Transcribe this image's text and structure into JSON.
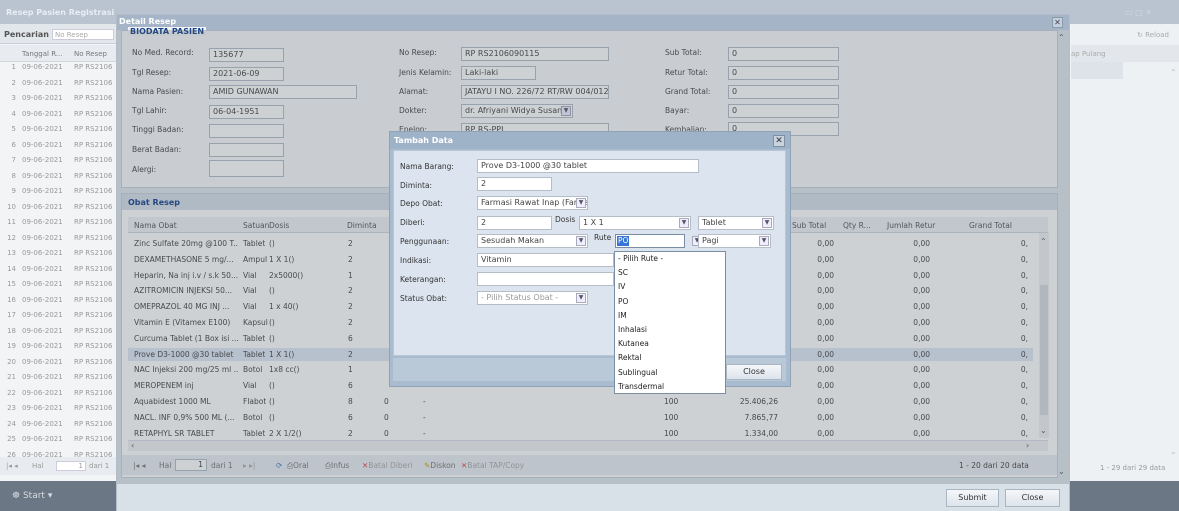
{
  "background": {
    "title": "Resep Pasien Registrasi",
    "search_label": "Pencarian :",
    "search_placeholder": "No Resep",
    "columns": [
      "Tanggal R...",
      "No Resep"
    ],
    "rows": [
      {
        "n": "1",
        "tgl": "09-06-2021",
        "no": "RP RS2106"
      },
      {
        "n": "2",
        "tgl": "09-06-2021",
        "no": "RP RS2106"
      },
      {
        "n": "3",
        "tgl": "09-06-2021",
        "no": "RP RS2106"
      },
      {
        "n": "4",
        "tgl": "09-06-2021",
        "no": "RP RS2106"
      },
      {
        "n": "5",
        "tgl": "09-06-2021",
        "no": "RP RS2106"
      },
      {
        "n": "6",
        "tgl": "09-06-2021",
        "no": "RP RS2106"
      },
      {
        "n": "7",
        "tgl": "09-06-2021",
        "no": "RP RS2106"
      },
      {
        "n": "8",
        "tgl": "09-06-2021",
        "no": "RP RS2106"
      },
      {
        "n": "9",
        "tgl": "09-06-2021",
        "no": "RP RS2106"
      },
      {
        "n": "10",
        "tgl": "09-06-2021",
        "no": "RP RS2106"
      },
      {
        "n": "11",
        "tgl": "09-06-2021",
        "no": "RP RS2106"
      },
      {
        "n": "12",
        "tgl": "09-06-2021",
        "no": "RP RS2106"
      },
      {
        "n": "13",
        "tgl": "09-06-2021",
        "no": "RP RS2106"
      },
      {
        "n": "14",
        "tgl": "09-06-2021",
        "no": "RP RS2106"
      },
      {
        "n": "15",
        "tgl": "09-06-2021",
        "no": "RP RS2106"
      },
      {
        "n": "16",
        "tgl": "09-06-2021",
        "no": "RP RS2106"
      },
      {
        "n": "17",
        "tgl": "09-06-2021",
        "no": "RP RS2106"
      },
      {
        "n": "18",
        "tgl": "09-06-2021",
        "no": "RP RS2106"
      },
      {
        "n": "19",
        "tgl": "09-06-2021",
        "no": "RP RS2106"
      },
      {
        "n": "20",
        "tgl": "09-06-2021",
        "no": "RP RS2106"
      },
      {
        "n": "21",
        "tgl": "09-06-2021",
        "no": "RP RS2106"
      },
      {
        "n": "22",
        "tgl": "09-06-2021",
        "no": "RP RS2106"
      },
      {
        "n": "23",
        "tgl": "09-06-2021",
        "no": "RP RS2106"
      },
      {
        "n": "24",
        "tgl": "09-06-2021",
        "no": "RP RS2106"
      },
      {
        "n": "25",
        "tgl": "09-06-2021",
        "no": "RP RS2106"
      },
      {
        "n": "26",
        "tgl": "09-06-2021",
        "no": "RP RS2106"
      }
    ],
    "pager_hal": "Hal",
    "pager_page": "1",
    "pager_of": "dari 1",
    "right_column": "ap Pulang",
    "reload": "Reload",
    "right_footer": "1 - 29 dari 29 data",
    "start": "Start"
  },
  "detail": {
    "title": "Detail Resep",
    "biodata_title": "BIODATA PASIEN",
    "fields": {
      "no_med_label": "No Med. Record:",
      "no_med": "135677",
      "tgl_resep_label": "Tgl Resep:",
      "tgl_resep": "2021-06-09",
      "nama_label": "Nama Pasien:",
      "nama": "AMID GUNAWAN",
      "tgl_lahir_label": "Tgl Lahir:",
      "tgl_lahir": "06-04-1951",
      "tinggi_label": "Tinggi Badan:",
      "berat_label": "Berat Badan:",
      "alergi_label": "Alergi:",
      "no_resep_label": "No Resep:",
      "no_resep": "RP RS2106090115",
      "jk_label": "Jenis Kelamin:",
      "jk": "Laki-laki",
      "alamat_label": "Alamat:",
      "alamat": "JATAYU I NO. 226/72 RT/RW 004/012",
      "dokter_label": "Dokter:",
      "dokter": "dr. Afriyani Widya Susanti",
      "poli_label": "Epelon:",
      "poli": "RP RS-PPI",
      "subtotal_label": "Sub Total:",
      "subtotal": "0",
      "retur_label": "Retur Total:",
      "retur": "0",
      "grand_label": "Grand Total:",
      "grand": "0",
      "bayar_label": "Bayar:",
      "bayar": "0",
      "kembalian_label": "Kembalian:",
      "kembalian": "0"
    },
    "obat_title": "Obat Resep",
    "columns": {
      "nama": "Nama Obat",
      "satuan": "Satuan",
      "dosis": "Dosis",
      "diminta": "Diminta",
      "subtotal": "Sub Total",
      "qtyr": "Qty R...",
      "jumlah_retur": "Jumlah Retur",
      "grand": "Grand Total"
    },
    "rows": [
      {
        "nama": "Zinc Sulfate 20mg @100 T...",
        "satuan": "Tablet",
        "dosis": "()",
        "diminta": "2",
        "harga": "",
        "qty": "",
        "total": "",
        "sub": "0,00",
        "jr": "0,00",
        "gt": "0,"
      },
      {
        "nama": "DEXAMETHASONE 5 mg/...",
        "satuan": "Ampul",
        "dosis": "1 X 1()",
        "diminta": "2",
        "harga": "",
        "qty": "",
        "total": "",
        "sub": "0,00",
        "jr": "0,00",
        "gt": "0,"
      },
      {
        "nama": "Heparin, Na inj i.v / s.k 50...",
        "satuan": "Vial",
        "dosis": "2x5000()",
        "diminta": "1",
        "harga": "",
        "qty": "",
        "total": "",
        "sub": "0,00",
        "jr": "0,00",
        "gt": "0,"
      },
      {
        "nama": "AZITROMICIN INJEKSI 50...",
        "satuan": "Vial",
        "dosis": "()",
        "diminta": "2",
        "harga": "",
        "qty": "",
        "total": "",
        "sub": "0,00",
        "jr": "0,00",
        "gt": "0,"
      },
      {
        "nama": "OMEPRAZOL 40 MG INJ ...",
        "satuan": "Vial",
        "dosis": "1 x 40()",
        "diminta": "2",
        "harga": "",
        "qty": "",
        "total": "",
        "sub": "0,00",
        "jr": "0,00",
        "gt": "0,"
      },
      {
        "nama": "Vitamin E (Vitamex E100)",
        "satuan": "Kapsul",
        "dosis": "()",
        "diminta": "2",
        "harga": "",
        "qty": "",
        "total": "",
        "sub": "0,00",
        "jr": "0,00",
        "gt": "0,"
      },
      {
        "nama": "Curcuma Tablet (1 Box isi ...",
        "satuan": "Tablet",
        "dosis": "()",
        "diminta": "6",
        "harga": "",
        "qty": "",
        "total": "",
        "sub": "0,00",
        "jr": "0,00",
        "gt": "0,"
      },
      {
        "nama": "Prove D3-1000 @30 tablet",
        "satuan": "Tablet",
        "dosis": "1 X 1()",
        "diminta": "2",
        "harga": "",
        "qty": "",
        "total": "",
        "sub": "0,00",
        "jr": "0,00",
        "gt": "0,"
      },
      {
        "nama": "NAC Injeksi 200 mg/25 ml ...",
        "satuan": "Botol",
        "dosis": "1x8 cc()",
        "diminta": "1",
        "harga": "",
        "qty": "",
        "total": "",
        "sub": "0,00",
        "jr": "0,00",
        "gt": "0,"
      },
      {
        "nama": "MEROPENEM inj",
        "satuan": "Vial",
        "dosis": "()",
        "diminta": "6",
        "harga": "",
        "qty": "",
        "total": "",
        "sub": "0,00",
        "jr": "0,00",
        "gt": "0,"
      },
      {
        "nama": "Aquabidest 1000 ML",
        "satuan": "Flabot",
        "dosis": "()",
        "diminta": "8",
        "harga": "0",
        "qty": "-",
        "total": "100",
        "st": "25.406,26",
        "sub": "0,00",
        "jr": "0,00",
        "gt": "0,"
      },
      {
        "nama": "NACL. INF 0,9% 500 ML (...",
        "satuan": "Botol",
        "dosis": "()",
        "diminta": "6",
        "harga": "0",
        "qty": "-",
        "total": "100",
        "st": "7.865,77",
        "sub": "0,00",
        "jr": "0,00",
        "gt": "0,"
      },
      {
        "nama": "RETAPHYL SR TABLET",
        "satuan": "Tablet",
        "dosis": "2 X 1/2()",
        "diminta": "2",
        "harga": "0",
        "qty": "-",
        "total": "100",
        "st": "1.334,00",
        "sub": "0,00",
        "jr": "0,00",
        "gt": "0,"
      }
    ],
    "pager": {
      "hal": "Hal",
      "page": "1",
      "of": "dari 1",
      "oral": "Oral",
      "infus": "Infus",
      "batal_diberi": "Batal Diberi",
      "diskon": "Diskon",
      "batal_tap": "Batal TAP/Copy",
      "count": "1 - 20 dari 20 data"
    },
    "submit": "Submit",
    "close": "Close"
  },
  "tambah": {
    "title": "Tambah Data",
    "nama_barang_label": "Nama Barang:",
    "nama_barang": "Prove D3-1000 @30 tablet",
    "diminta_label": "Diminta:",
    "diminta": "2",
    "depo_label": "Depo Obat:",
    "depo": "Farmasi Rawat Inap (Farmasi",
    "diberi_label": "Diberi:",
    "diberi": "2",
    "dosis_label": "Dosis",
    "dosis": "1 X 1",
    "satuan": "Tablet",
    "penggunaan_label": "Penggunaan:",
    "penggunaan": "Sesudah Makan",
    "rute_label": "Rute",
    "rute": "PO",
    "waktu": "Pagi",
    "indikasi_label": "Indikasi:",
    "indikasi": "Vitamin",
    "keterangan_label": "Keterangan:",
    "status_label": "Status Obat:",
    "status_placeholder": "- Pilih Status Obat -",
    "close": "Close",
    "rute_options": [
      "- Pilih Rute -",
      "SC",
      "IV",
      "PO",
      "IM",
      "Inhalasi",
      "Kutanea",
      "Rektal",
      "Sublingual",
      "Transdermal"
    ]
  }
}
